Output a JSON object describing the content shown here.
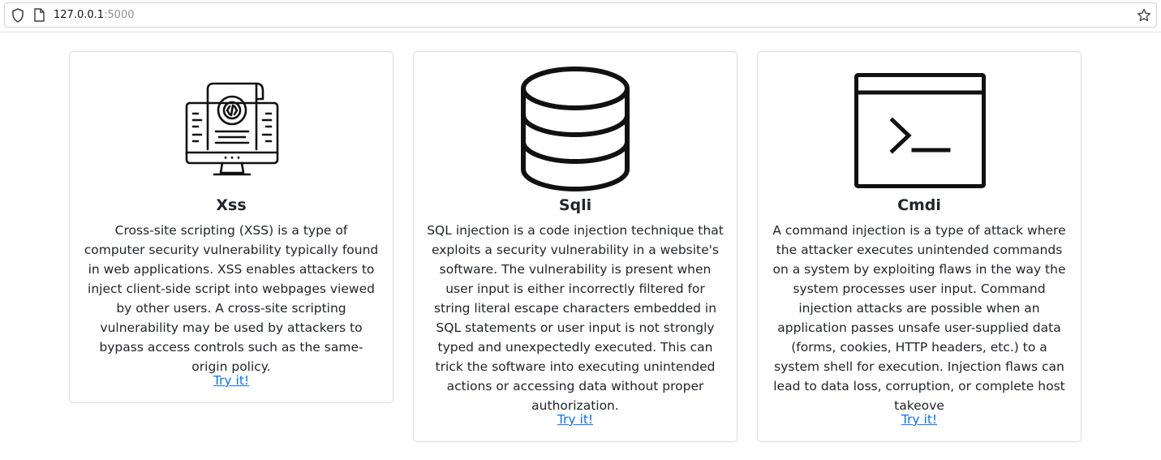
{
  "browser": {
    "url_host": "127.0.0.1",
    "url_port": ":5000"
  },
  "cards": [
    {
      "title": "Xss",
      "icon": "code-monitor-icon",
      "description": "Cross-site scripting (XSS) is a type of computer security vulnerability typically found in web applications. XSS enables attackers to inject client-side script into webpages viewed by other users. A cross-site scripting vulnerability may be used by attackers to bypass access controls such as the same-origin policy.",
      "link": "Try it!"
    },
    {
      "title": "Sqli",
      "icon": "database-icon",
      "description": "SQL injection is a code injection technique that exploits a security vulnerability in a website's software. The vulnerability is present when user input is either incorrectly filtered for string literal escape characters embedded in SQL statements or user input is not strongly typed and unexpectedly executed. This can trick the software into executing unintended actions or accessing data without proper authorization.",
      "link": "Try it!"
    },
    {
      "title": "Cmdi",
      "icon": "terminal-icon",
      "description": "A command injection is a type of attack where the attacker executes unintended commands on a system by exploiting flaws in the way the system processes user input. Command injection attacks are possible when an application passes unsafe user-supplied data (forms, cookies, HTTP headers, etc.) to a system shell for execution. Injection flaws can lead to data loss, corruption, or complete host takeove",
      "link": "Try it!"
    }
  ]
}
